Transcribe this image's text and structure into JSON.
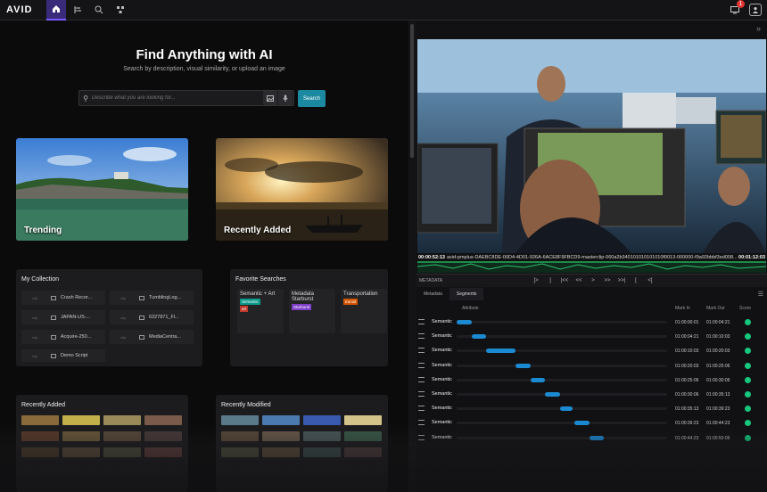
{
  "topbar": {
    "logo": "AVID",
    "notification_count": "1",
    "icons": [
      "home-icon",
      "workflow-icon",
      "search-icon",
      "connections-icon",
      "notification-icon",
      "user-icon"
    ]
  },
  "search_page": {
    "title": "Find Anything with AI",
    "subtitle": "Search by description, visual similarity, or upload an image",
    "search_placeholder": "Describe what you are looking for...",
    "search_button": "Search"
  },
  "cards": {
    "trending": "Trending",
    "recently_added": "Recently Added"
  },
  "my_collection": {
    "title": "My Collection",
    "items": [
      {
        "thumb": "clip",
        "name": "Crash Recor..."
      },
      {
        "thumb": "clip",
        "name": "TumblingLog..."
      },
      {
        "thumb": "clip",
        "name": "JAPAN-US-..."
      },
      {
        "thumb": "clip",
        "name": "6327871_Fl..."
      },
      {
        "thumb": "clip",
        "name": "Acquire-250..."
      },
      {
        "thumb": "clip",
        "name": "MediaCentra..."
      },
      {
        "thumb": "clip",
        "name": "Demo Script"
      }
    ]
  },
  "favorite_searches": {
    "title": "Favorite Searches",
    "items": [
      {
        "name": "Semantic + Art",
        "tags": [
          {
            "label": "Semantic",
            "color": "#0b9a8a"
          },
          {
            "label": "art",
            "color": "#c0392b"
          }
        ]
      },
      {
        "name": "Metadata Starburst",
        "tags": [
          {
            "label": "Starburst",
            "color": "#7d3fc7"
          }
        ]
      },
      {
        "name": "Transportation",
        "tags": [
          {
            "label": "transit",
            "color": "#d35400"
          }
        ]
      }
    ]
  },
  "recently_added_panel": {
    "title": "Recently Added"
  },
  "recently_modified_panel": {
    "title": "Recently Modified"
  },
  "player": {
    "timecode_in": "00:00:52:13",
    "clip_name": "avid-pmplus-DAEBC8DE-00D4-4D01-926A-6ACE8F9FBCD9-masterclip-060a2b340101010101010f0013-000000-f9a92bbbf3ed008...",
    "timecode_out": "00:01:12:03",
    "metadata_label": "METADATA",
    "controls": [
      "]>",
      "]",
      "|<<",
      "<<",
      ">",
      ">>",
      ">>|",
      "[",
      "<["
    ]
  },
  "segments": {
    "tabs": [
      "Metadata",
      "Segments"
    ],
    "columns": {
      "attribute": "Attribute",
      "mark_in": "Mark In",
      "mark_out": "Mark Out",
      "score": "Score"
    },
    "rows": [
      {
        "label": "Semantic",
        "mark_in": "01:00:00:01",
        "mark_out": "01:00:04:21",
        "start": 0.0,
        "width": 0.07
      },
      {
        "label": "Semantic",
        "mark_in": "01:00:04:21",
        "mark_out": "01:00:10:03",
        "start": 0.07,
        "width": 0.07
      },
      {
        "label": "Semantic",
        "mark_in": "01:00:10:03",
        "mark_out": "01:00:20:03",
        "start": 0.14,
        "width": 0.14
      },
      {
        "label": "Semantic",
        "mark_in": "01:00:20:03",
        "mark_out": "01:00:25:06",
        "start": 0.28,
        "width": 0.07
      },
      {
        "label": "Semantic",
        "mark_in": "01:00:25:06",
        "mark_out": "01:00:30:06",
        "start": 0.35,
        "width": 0.07
      },
      {
        "label": "Semantic",
        "mark_in": "01:00:30:06",
        "mark_out": "01:00:35:13",
        "start": 0.42,
        "width": 0.07
      },
      {
        "label": "Semantic",
        "mark_in": "01:00:35:13",
        "mark_out": "01:00:39:23",
        "start": 0.49,
        "width": 0.06
      },
      {
        "label": "Semantic",
        "mark_in": "01:00:39:23",
        "mark_out": "01:00:44:23",
        "start": 0.56,
        "width": 0.07
      },
      {
        "label": "Semantic",
        "mark_in": "01:00:44:23",
        "mark_out": "01:00:50:06",
        "start": 0.63,
        "width": 0.07
      }
    ]
  },
  "colors": {
    "accent": "#1b8aa0",
    "brand": "#7b5cff",
    "score_green": "#17c77e",
    "segment_blue": "#1b8ad0"
  }
}
